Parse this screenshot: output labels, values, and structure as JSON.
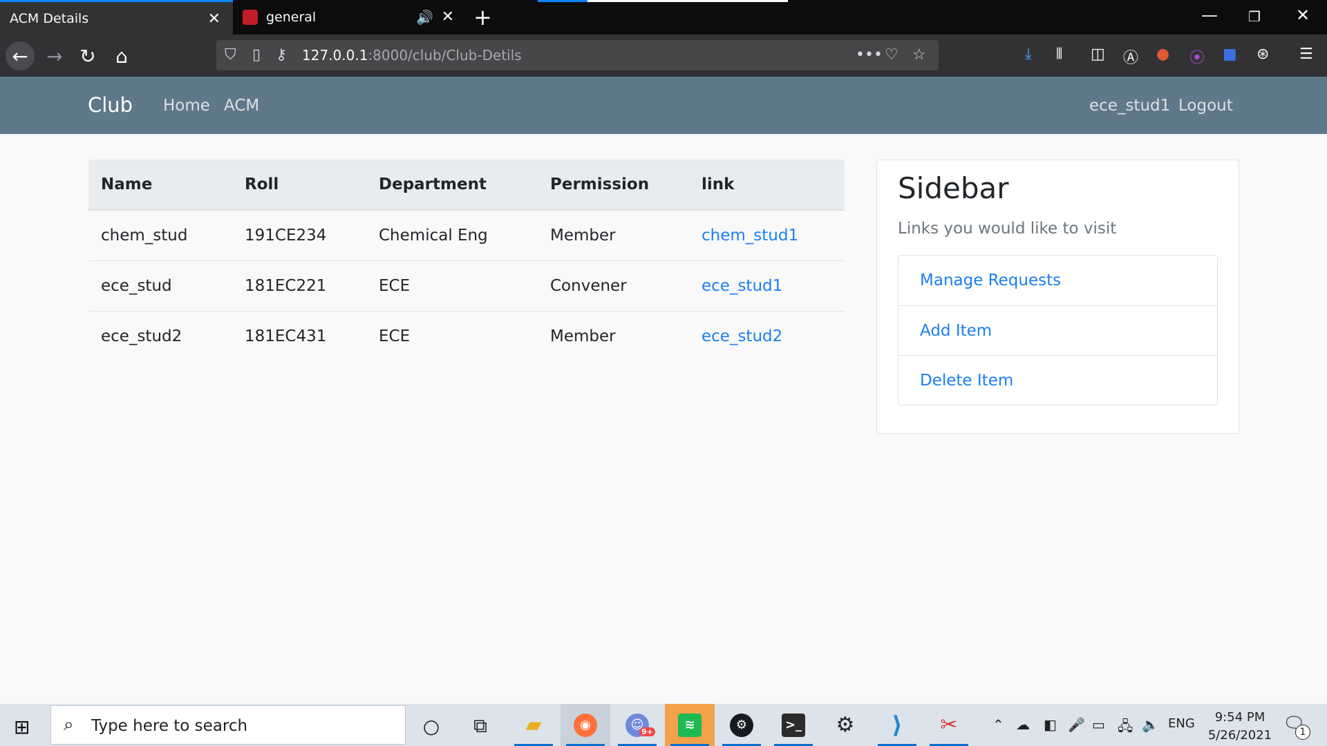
{
  "browser": {
    "tabs": [
      {
        "title": "ACM Details",
        "active": true
      },
      {
        "title": "general",
        "active": false,
        "playing_audio": true
      }
    ],
    "url_host": "127.0.0.1",
    "url_path": ":8000/club/Club-Detils"
  },
  "site": {
    "brand": "Club",
    "nav_links": [
      "Home",
      "ACM"
    ],
    "user": "ece_stud1",
    "logout": "Logout"
  },
  "table": {
    "headers": [
      "Name",
      "Roll",
      "Department",
      "Permission",
      "link"
    ],
    "rows": [
      [
        "chem_stud",
        "191CE234",
        "Chemical Eng",
        "Member",
        "chem_stud1"
      ],
      [
        "ece_stud",
        "181EC221",
        "ECE",
        "Convener",
        "ece_stud1"
      ],
      [
        "ece_stud2",
        "181EC431",
        "ECE",
        "Member",
        "ece_stud2"
      ]
    ]
  },
  "sidebar": {
    "title": "Sidebar",
    "subtitle": "Links you would like to visit",
    "links": [
      "Manage Requests",
      "Add Item",
      "Delete Item"
    ]
  },
  "taskbar": {
    "search_placeholder": "Type here to search",
    "language": "ENG",
    "time": "9:54 PM",
    "date": "5/26/2021",
    "notification_count": "1",
    "discord_badge": "9+"
  },
  "colors": {
    "site_nav": "#5f788a",
    "link": "#1a7ff0",
    "browser_dark": "#0c0c0d",
    "browser_toolbar": "#323234"
  }
}
